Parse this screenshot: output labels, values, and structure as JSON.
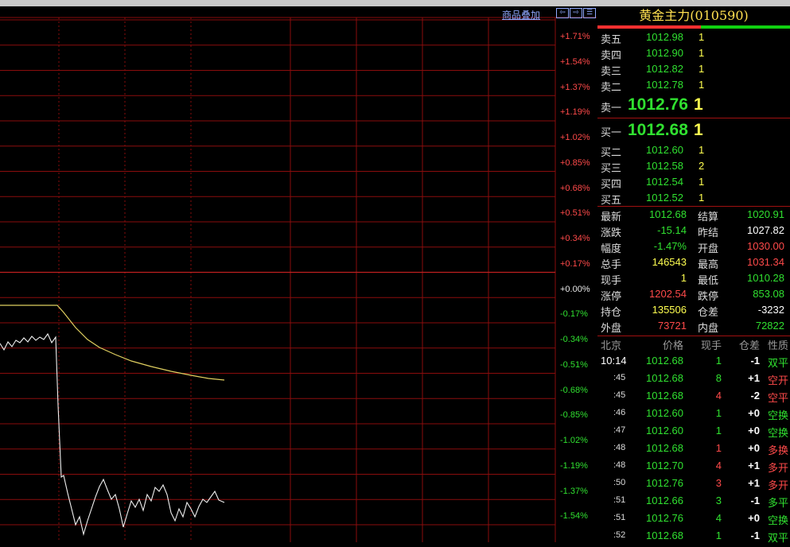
{
  "toolbar": {
    "overlay_label": "商品叠加",
    "nav_left": "⇦",
    "nav_right": "⇨",
    "nav_menu": "☰"
  },
  "chart": {
    "pct_labels_red": [
      "+1.71%",
      "+1.54%",
      "+1.37%",
      "+1.19%",
      "+1.02%",
      "+0.85%",
      "+0.68%",
      "+0.51%",
      "+0.34%",
      "+0.17%"
    ],
    "pct_zero": "+0.00%",
    "pct_labels_green": [
      "-0.17%",
      "-0.34%",
      "-0.51%",
      "-0.68%",
      "-0.85%",
      "-1.02%",
      "-1.19%",
      "-1.37%",
      "-1.54%"
    ]
  },
  "panel": {
    "title": "黄金主力(010590)",
    "asks": [
      {
        "label": "卖五",
        "price": "1012.98",
        "vol": "1"
      },
      {
        "label": "卖四",
        "price": "1012.90",
        "vol": "1"
      },
      {
        "label": "卖三",
        "price": "1012.82",
        "vol": "1"
      },
      {
        "label": "卖二",
        "price": "1012.78",
        "vol": "1"
      }
    ],
    "ask1": {
      "label": "卖一",
      "price": "1012.76",
      "vol": "1"
    },
    "bid1": {
      "label": "买一",
      "price": "1012.68",
      "vol": "1"
    },
    "bids": [
      {
        "label": "买二",
        "price": "1012.60",
        "vol": "1"
      },
      {
        "label": "买三",
        "price": "1012.58",
        "vol": "2"
      },
      {
        "label": "买四",
        "price": "1012.54",
        "vol": "1"
      },
      {
        "label": "买五",
        "price": "1012.52",
        "vol": "1"
      }
    ],
    "stats": [
      {
        "l1": "最新",
        "v1": "1012.68",
        "l2": "结算",
        "v2": "1020.91"
      },
      {
        "l1": "涨跌",
        "v1": "-15.14",
        "l2": "昨结",
        "v2": "1027.82"
      },
      {
        "l1": "幅度",
        "v1": "-1.47%",
        "l2": "开盘",
        "v2": "1030.00"
      },
      {
        "l1": "总手",
        "v1": "146543",
        "l2": "最高",
        "v2": "1031.34"
      },
      {
        "l1": "现手",
        "v1": "1",
        "l2": "最低",
        "v2": "1010.28"
      },
      {
        "l1": "涨停",
        "v1": "1202.54",
        "l2": "跌停",
        "v2": "853.08"
      },
      {
        "l1": "持仓",
        "v1": "135506",
        "l2": "仓差",
        "v2": "-3232"
      },
      {
        "l1": "外盘",
        "v1": "73721",
        "l2": "内盘",
        "v2": "72822"
      }
    ],
    "ticks_header": {
      "time": "北京",
      "price": "价格",
      "vol": "现手",
      "diff": "仓差",
      "nature": "性质"
    },
    "ticks": [
      {
        "time": "10:14",
        "price": "1012.68",
        "vol": "1",
        "diff": "-1",
        "nature": "双平"
      },
      {
        "time": ":45",
        "price": "1012.68",
        "vol": "8",
        "diff": "+1",
        "nature": "空开"
      },
      {
        "time": ":45",
        "price": "1012.68",
        "vol": "4",
        "diff": "-2",
        "nature": "空平"
      },
      {
        "time": ":46",
        "price": "1012.60",
        "vol": "1",
        "diff": "+0",
        "nature": "空换"
      },
      {
        "time": ":47",
        "price": "1012.60",
        "vol": "1",
        "diff": "+0",
        "nature": "空换"
      },
      {
        "time": ":48",
        "price": "1012.68",
        "vol": "1",
        "diff": "+0",
        "nature": "多换"
      },
      {
        "time": ":48",
        "price": "1012.70",
        "vol": "4",
        "diff": "+1",
        "nature": "多开"
      },
      {
        "time": ":50",
        "price": "1012.76",
        "vol": "3",
        "diff": "+1",
        "nature": "多开"
      },
      {
        "time": ":51",
        "price": "1012.66",
        "vol": "3",
        "diff": "-1",
        "nature": "多平"
      },
      {
        "time": ":51",
        "price": "1012.76",
        "vol": "4",
        "diff": "+0",
        "nature": "空换"
      },
      {
        "time": ":52",
        "price": "1012.68",
        "vol": "1",
        "diff": "-1",
        "nature": "双平"
      }
    ]
  }
}
